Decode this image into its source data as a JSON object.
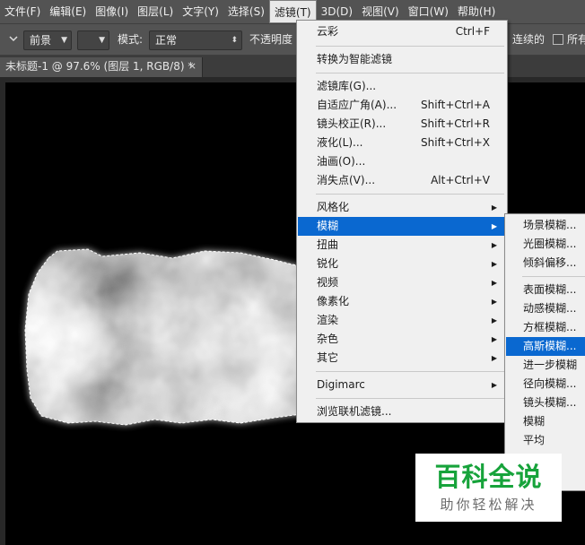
{
  "menubar": {
    "items": [
      "文件(F)",
      "编辑(E)",
      "图像(I)",
      "图层(L)",
      "文字(Y)",
      "选择(S)",
      "滤镜(T)",
      "3D(D)",
      "视图(V)",
      "窗口(W)",
      "帮助(H)"
    ],
    "active_index": 6
  },
  "options": {
    "foreground_label": "前景",
    "mode_label": "模式:",
    "mode_value": "正常",
    "opacity_label": "不透明度",
    "contiguous_label": "连续的",
    "all_layers_label": "所有"
  },
  "document_tab": {
    "title": "未标题-1 @ 97.6% (图层 1, RGB/8) *",
    "close_glyph": "×"
  },
  "filter_menu": {
    "items": [
      {
        "label": "云彩",
        "shortcut": "Ctrl+F"
      },
      {
        "label": "转换为智能滤镜",
        "shortcut": ""
      },
      {
        "label": "滤镜库(G)...",
        "shortcut": ""
      },
      {
        "label": "自适应广角(A)...",
        "shortcut": "Shift+Ctrl+A"
      },
      {
        "label": "镜头校正(R)...",
        "shortcut": "Shift+Ctrl+R"
      },
      {
        "label": "液化(L)...",
        "shortcut": "Shift+Ctrl+X"
      },
      {
        "label": "油画(O)...",
        "shortcut": ""
      },
      {
        "label": "消失点(V)...",
        "shortcut": "Alt+Ctrl+V"
      },
      {
        "label": "风格化",
        "shortcut": ""
      },
      {
        "label": "模糊",
        "shortcut": ""
      },
      {
        "label": "扭曲",
        "shortcut": ""
      },
      {
        "label": "锐化",
        "shortcut": ""
      },
      {
        "label": "视频",
        "shortcut": ""
      },
      {
        "label": "像素化",
        "shortcut": ""
      },
      {
        "label": "渲染",
        "shortcut": ""
      },
      {
        "label": "杂色",
        "shortcut": ""
      },
      {
        "label": "其它",
        "shortcut": ""
      },
      {
        "label": "Digimarc",
        "shortcut": ""
      },
      {
        "label": "浏览联机滤镜...",
        "shortcut": ""
      }
    ],
    "highlighted": "模糊"
  },
  "blur_menu": {
    "items": [
      "场景模糊...",
      "光圈模糊...",
      "倾斜偏移...",
      "表面模糊...",
      "动感模糊...",
      "方框模糊...",
      "高斯模糊...",
      "进一步模糊",
      "径向模糊...",
      "镜头模糊...",
      "模糊",
      "平均"
    ],
    "highlighted": "高斯模糊..."
  },
  "watermark": {
    "title": "百科全说",
    "subtitle": "助你轻松解决"
  },
  "colors": {
    "menu_highlight": "#0a68d0",
    "watermark_green": "#17a33b",
    "panel_bg": "#535353"
  }
}
